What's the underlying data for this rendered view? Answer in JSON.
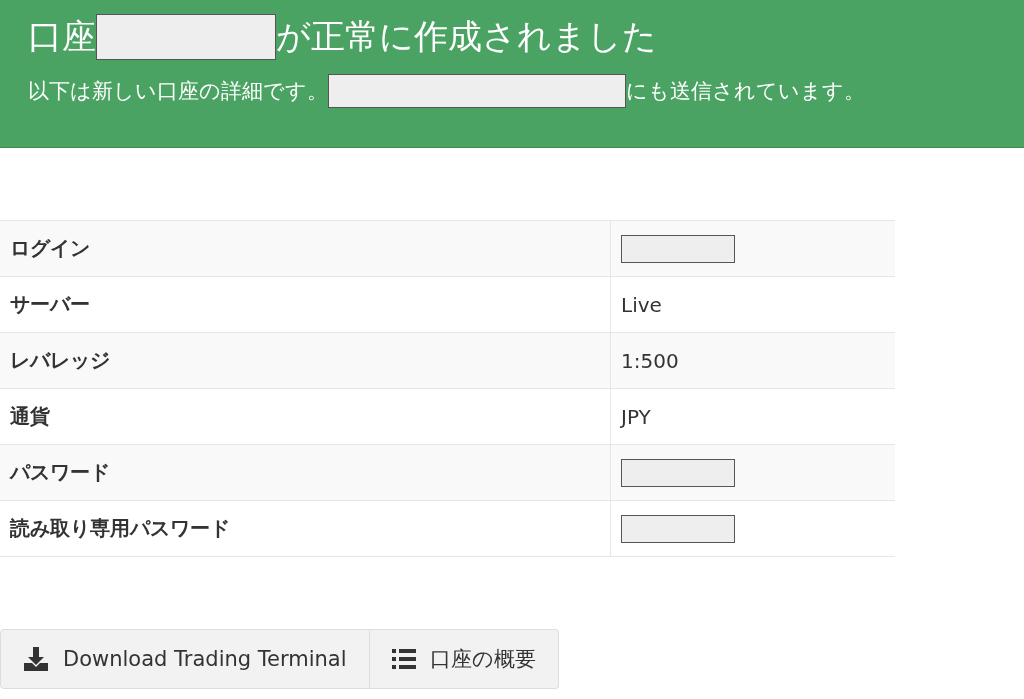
{
  "header": {
    "title_before": "口座",
    "title_after": "が正常に作成されました",
    "subtitle_before": "以下は新しい口座の詳細です。",
    "subtitle_after": "にも送信されています。"
  },
  "details": [
    {
      "label": "ログイン",
      "kind": "redacted"
    },
    {
      "label": "サーバー",
      "kind": "text",
      "value": "Live"
    },
    {
      "label": "レバレッジ",
      "kind": "text",
      "value": "1:500"
    },
    {
      "label": "通貨",
      "kind": "text",
      "value": "JPY"
    },
    {
      "label": "パスワード",
      "kind": "redacted"
    },
    {
      "label": "読み取り専用パスワード",
      "kind": "redacted"
    }
  ],
  "buttons": [
    {
      "kind": "download",
      "label": "Download Trading Terminal"
    },
    {
      "kind": "list",
      "label": "口座の概要"
    }
  ]
}
